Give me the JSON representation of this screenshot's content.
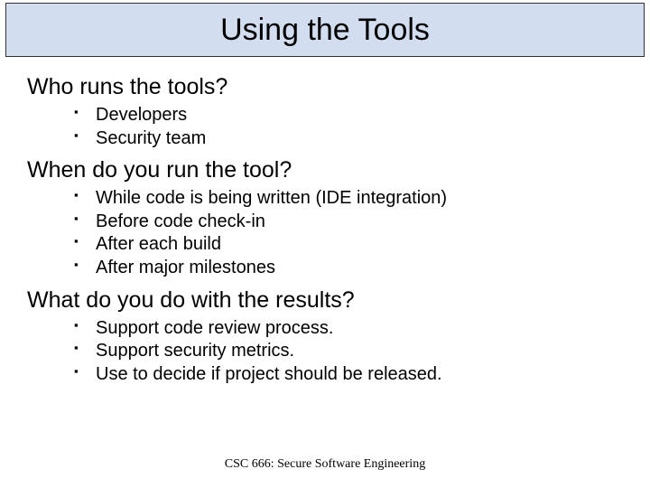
{
  "title": "Using the Tools",
  "sections": [
    {
      "question": "Who runs the tools?",
      "items": [
        "Developers",
        "Security team"
      ]
    },
    {
      "question": "When do you run the tool?",
      "items": [
        "While code is being written (IDE integration)",
        "Before code check-in",
        "After each build",
        "After major milestones"
      ]
    },
    {
      "question": "What do you do with the results?",
      "items": [
        "Support code review process.",
        "Support security metrics.",
        "Use to decide if project should be released."
      ]
    }
  ],
  "footer": "CSC 666: Secure Software Engineering"
}
